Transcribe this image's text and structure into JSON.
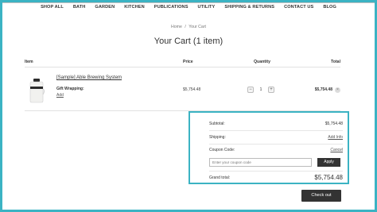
{
  "nav": {
    "items": [
      "SHOP ALL",
      "BATH",
      "GARDEN",
      "KITCHEN",
      "PUBLICATIONS",
      "UTILITY",
      "SHIPPING & RETURNS",
      "CONTACT US",
      "BLOG"
    ]
  },
  "breadcrumb": {
    "home": "Home",
    "separator": "/",
    "current": "Your Cart"
  },
  "page_title": "Your Cart (1 item)",
  "table": {
    "headers": {
      "item": "Item",
      "price": "Price",
      "quantity": "Quantity",
      "total": "Total"
    }
  },
  "line_item": {
    "name": "[Sample] Able Brewing System",
    "gift_wrapping_label": "Gift Wrapping:",
    "gift_wrapping_action": "Add",
    "price": "$5,754.48",
    "quantity": "1",
    "decrement_symbol": "−",
    "increment_symbol": "+",
    "total": "$5,754.48",
    "remove_symbol": "×"
  },
  "summary": {
    "subtotal_label": "Subtotal:",
    "subtotal_value": "$5,754.48",
    "shipping_label": "Shipping:",
    "shipping_action": "Add Info",
    "coupon_label": "Coupon Code:",
    "coupon_action": "Cancel",
    "coupon_placeholder": "Enter your coupon code",
    "apply_label": "Apply",
    "grand_total_label": "Grand total:",
    "grand_total_value": "$5,754.48"
  },
  "checkout_label": "Check out",
  "colors": {
    "highlight": "#3bb3c3",
    "button": "#333333"
  }
}
